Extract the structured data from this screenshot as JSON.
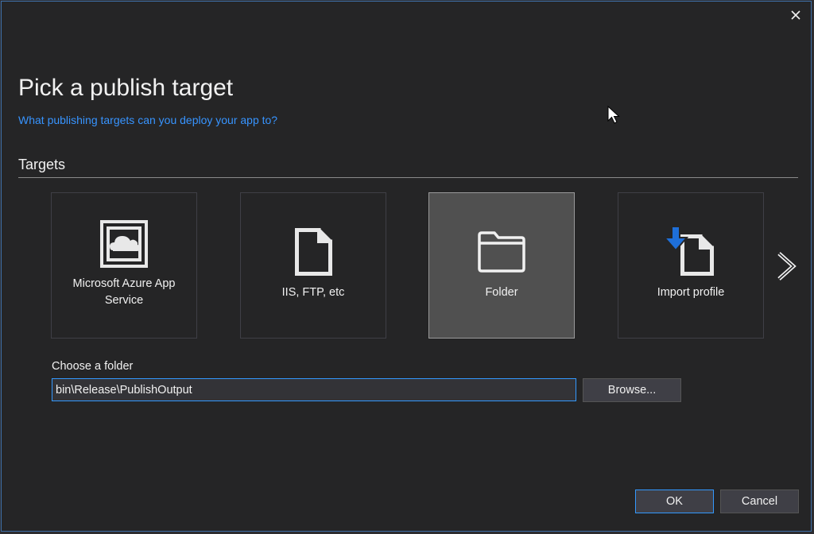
{
  "dialog": {
    "title": "Pick a publish target",
    "help_link": "What publishing targets can you deploy your app to?",
    "close_icon": "close-icon"
  },
  "targets": {
    "section_label": "Targets",
    "items": [
      {
        "label": "Microsoft Azure App Service",
        "icon": "azure-app-service-icon",
        "selected": false
      },
      {
        "label": "IIS, FTP, etc",
        "icon": "document-icon",
        "selected": false
      },
      {
        "label": "Folder",
        "icon": "folder-icon",
        "selected": true
      },
      {
        "label": "Import profile",
        "icon": "import-profile-icon",
        "selected": false
      }
    ],
    "next_icon": "chevron-right-icon"
  },
  "folder": {
    "label": "Choose a folder",
    "value": "bin\\Release\\PublishOutput",
    "browse_label": "Browse..."
  },
  "footer": {
    "ok_label": "OK",
    "cancel_label": "Cancel"
  },
  "colors": {
    "accent": "#3399ff",
    "link": "#3794ff",
    "background": "#252526",
    "selected_tile": "#505050",
    "import_arrow": "#1e6fd9"
  }
}
